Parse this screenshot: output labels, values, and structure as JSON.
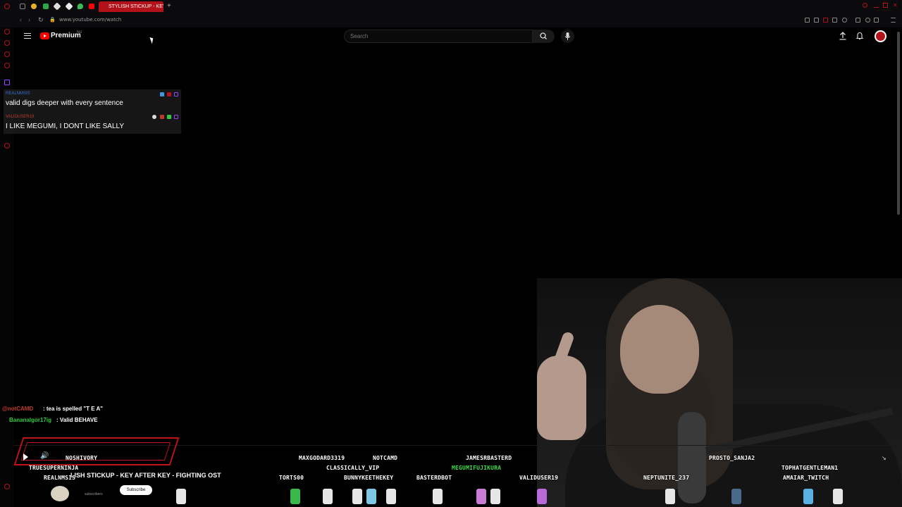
{
  "browser": {
    "active_tab": "STYLISH STICKUP - KEY",
    "new_tab": "+",
    "url": "www.youtube.com/watch"
  },
  "youtube": {
    "brand": "Premium",
    "region": "NU",
    "search_placeholder": "Search"
  },
  "overlay_chat": [
    {
      "user": "REALNMSIS",
      "user_color": "#3b6fd6",
      "message": "valid digs deeper with every sentence"
    },
    {
      "user": "VALIDUSER19",
      "user_color": "#c0392b",
      "message": "I LIKE MEGUMI, I DONT LIKE SALLY"
    }
  ],
  "lower_chat": [
    {
      "user": "@notCAMD",
      "user_color": "#c0392b",
      "message": ": tea is spelled \"T E A\""
    },
    {
      "user": "Bananalgor17ig",
      "user_color": "#2ecc40",
      "message": ": Valid BEHAVE"
    }
  ],
  "player": {
    "overlay_name": "NOSHIVORY",
    "video_title": "LISH STICKUP - KEY AFTER KEY - FIGHTING OST",
    "subscribe": "Subscribe",
    "subscribers_label": "subscribers"
  },
  "viewer_names": [
    {
      "name": "TRUESUPERNINJA",
      "color": "#ffffff"
    },
    {
      "name": "REALNMSIS",
      "color": "#ffffff"
    },
    {
      "name": "MAXGODARD3319",
      "color": "#ffffff"
    },
    {
      "name": "NOTCAMD",
      "color": "#ffffff"
    },
    {
      "name": "CLASSICALLY_VIP",
      "color": "#ffffff"
    },
    {
      "name": "TORTS00",
      "color": "#ffffff"
    },
    {
      "name": "BUNNYKEETHEKEY",
      "color": "#ffffff"
    },
    {
      "name": "BASTERDBOT",
      "color": "#ffffff"
    },
    {
      "name": "JAMESRBASTERD",
      "color": "#ffffff"
    },
    {
      "name": "MEGUMIFUJIKURA",
      "color": "#3ddc4a"
    },
    {
      "name": "VALIDUSER19",
      "color": "#ffffff"
    },
    {
      "name": "PROSTO_SANJA2",
      "color": "#ffffff"
    },
    {
      "name": "NEPTUNITE_237",
      "color": "#ffffff"
    },
    {
      "name": "TOPHATGENTLEMAN1",
      "color": "#ffffff"
    },
    {
      "name": "AMAIAR_TWITCH",
      "color": "#ffffff"
    }
  ],
  "colors": {
    "accent": "#b4121b",
    "youtube_red": "#ff0000"
  }
}
